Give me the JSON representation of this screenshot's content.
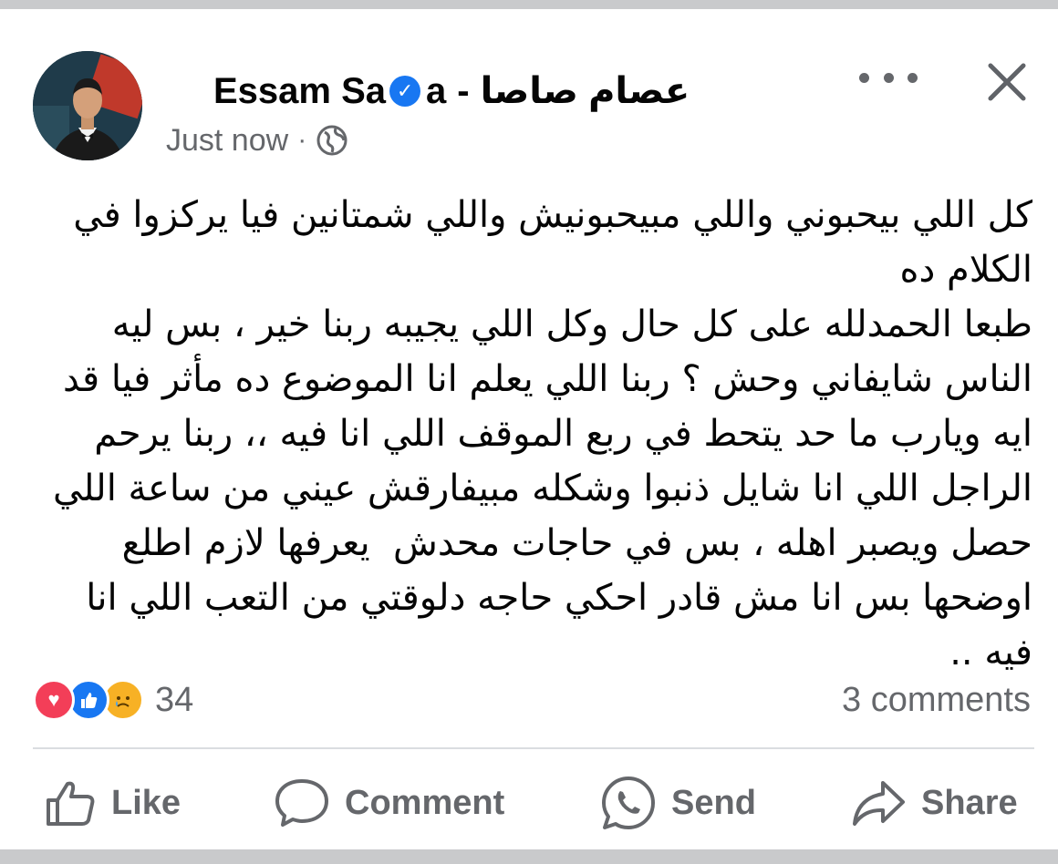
{
  "post": {
    "author_name_latin": "Essam Sa",
    "author_name_suffix": "a",
    "separator": "-",
    "author_name_arabic": "عصام صاصا",
    "timestamp": "Just now",
    "meta_dot": "·",
    "privacy_icon": "globe-icon",
    "text_lines": [
      "كل اللي بيحبوني واللي مبيحبونيش واللي شمتانين فيا يركزوا في الكلام ده",
      "طبعا الحمدلله على كل حال وكل اللي يجيبه ربنا خير ، بس ليه الناس شايفاني وحش ؟ ربنا اللي يعلم انا الموضوع ده مأثر فيا قد ايه ويارب ما حد يتحط في ربع الموقف اللي انا فيه ،، ربنا يرحم الراجل اللي انا شايل ذنبوا وشكله مبيفارقش عيني من ساعة اللي حصل ويصبر اهله ، بس في حاجات محدش  يعرفها لازم اطلع اوضحها بس انا مش قادر احكي حاجه دلوقتي من التعب اللي انا فيه .."
    ]
  },
  "reactions": {
    "icons": [
      "love-icon",
      "like-icon",
      "sad-icon"
    ],
    "count": "34"
  },
  "comments_count": "3 comments",
  "actions": {
    "like": "Like",
    "comment": "Comment",
    "send": "Send",
    "share": "Share"
  },
  "colors": {
    "accent": "#1877f2",
    "secondary_text": "#65676b",
    "love": "#f33e58",
    "sad": "#f7b125"
  }
}
